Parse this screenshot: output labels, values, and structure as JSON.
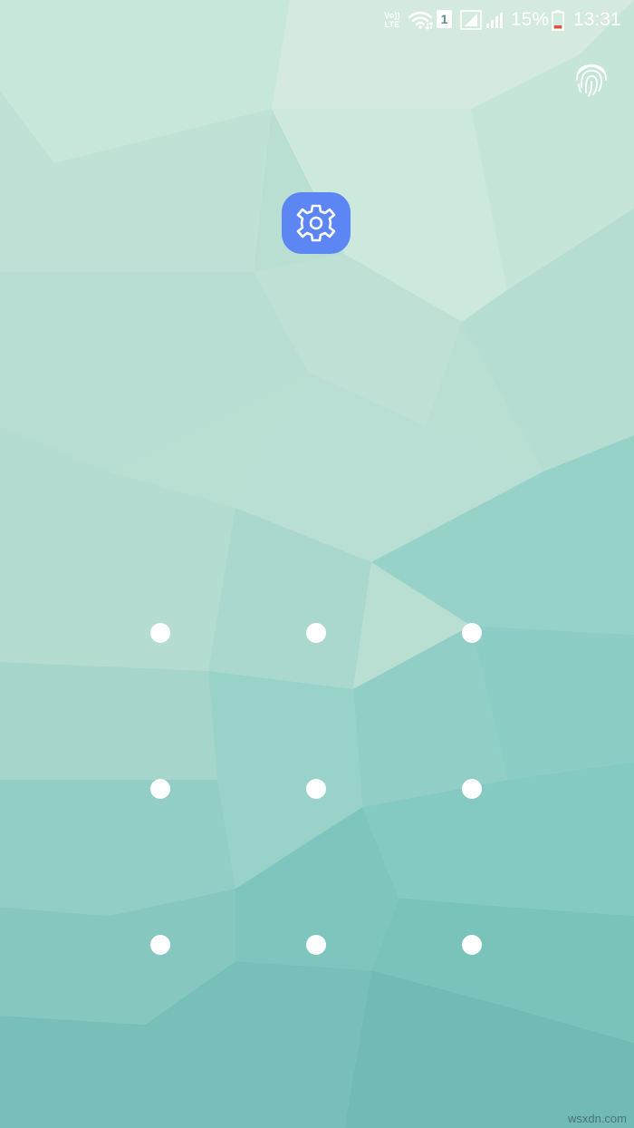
{
  "status_bar": {
    "volte_line1": "Vo))",
    "volte_line2": "LTE",
    "sim_slot": "1",
    "battery_percent": "15%",
    "time": "13:31",
    "icons": [
      "volte-icon",
      "wifi-icon",
      "sim-1-icon",
      "signal-icon",
      "signal-icon-2",
      "battery-low-icon"
    ]
  },
  "lock_screen": {
    "fingerprint_icon": "fingerprint-icon",
    "app_icon": "settings-gear-icon",
    "app_icon_color": "#5b86f4",
    "pattern_dots": 9
  },
  "watermark": "wsxdn.com"
}
